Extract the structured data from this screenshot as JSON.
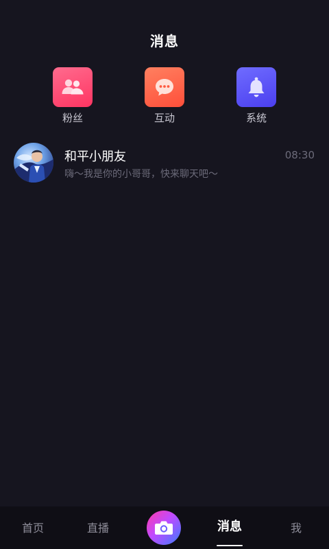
{
  "header": {
    "title": "消息"
  },
  "quick_actions": [
    {
      "label": "粉丝",
      "icon": "fans-icon",
      "color": "#ff5277"
    },
    {
      "label": "互动",
      "icon": "chat-bubble-icon",
      "color": "#ff6a4d"
    },
    {
      "label": "系统",
      "icon": "bell-icon",
      "color": "#5d57ff"
    }
  ],
  "conversations": [
    {
      "name": "和平小朋友",
      "preview": "嗨～我是你的小哥哥，快来聊天吧～",
      "time": "08:30"
    }
  ],
  "tabbar": {
    "home": "首页",
    "live": "直播",
    "messages": "消息",
    "me": "我",
    "active": "消息"
  },
  "colors": {
    "background": "#16151f",
    "tabbar_background": "#0f0e15",
    "muted_text": "#6c6b7a"
  }
}
